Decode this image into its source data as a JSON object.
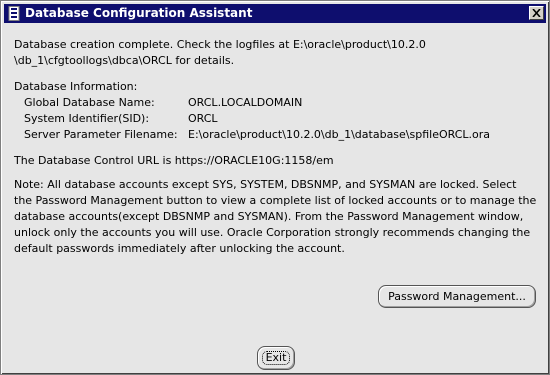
{
  "window": {
    "title": "Database Configuration Assistant",
    "title_icon": "oracle-app-icon",
    "close_icon": "close-icon"
  },
  "message": {
    "line1": "Database creation complete. Check the logfiles at E:\\oracle\\product\\10.2.0",
    "line2": "\\db_1\\cfgtoollogs\\dbca\\ORCL for details."
  },
  "database_info": {
    "heading": "Database Information:",
    "rows": [
      {
        "label": "Global Database Name:",
        "value": "ORCL.LOCALDOMAIN"
      },
      {
        "label": "System Identifier(SID):",
        "value": "ORCL"
      },
      {
        "label": "Server Parameter Filename:",
        "value": "E:\\oracle\\product\\10.2.0\\db_1\\database\\spfileORCL.ora"
      }
    ]
  },
  "control_url": "The Database Control URL is https://ORACLE10G:1158/em",
  "note_lines": [
    "Note: All database accounts except SYS, SYSTEM, DBSNMP, and SYSMAN are locked. Select",
    "the Password Management button to view a complete list of locked accounts or to manage the",
    "database accounts(except DBSNMP and SYSMAN). From the Password Management window,",
    "unlock only the accounts you will use. Oracle Corporation strongly recommends changing the",
    "default passwords immediately after unlocking the account."
  ],
  "buttons": {
    "password_management": "Password Management...",
    "exit": "Exit"
  }
}
